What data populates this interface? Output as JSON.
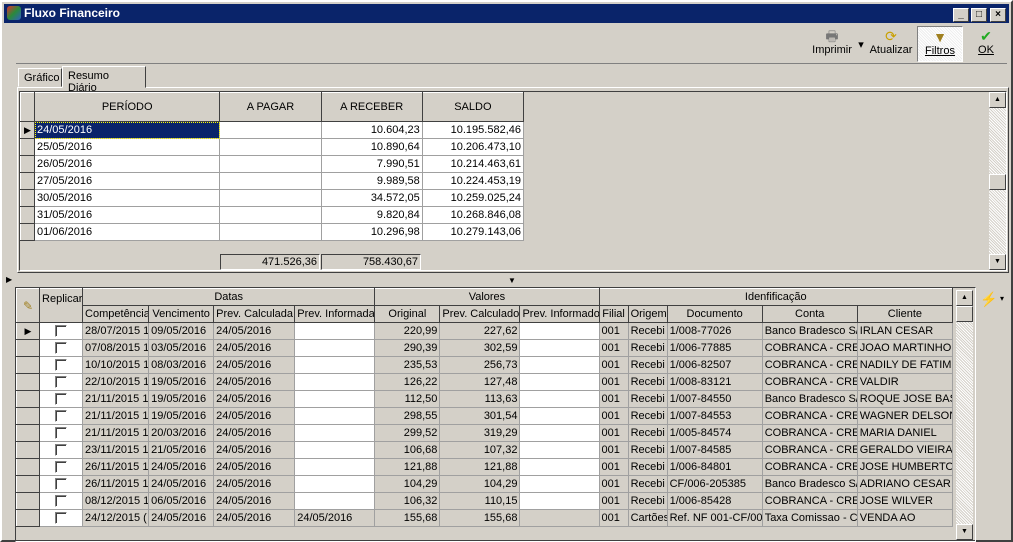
{
  "window": {
    "title": "Fluxo Financeiro",
    "min": "_",
    "max": "□",
    "close": "×"
  },
  "toolbar": {
    "print": "Imprimir",
    "refresh": "Atualizar",
    "filters": "Filtros",
    "ok": "OK"
  },
  "tabs": [
    {
      "label": "Gráfico"
    },
    {
      "label": "Resumo Diário"
    }
  ],
  "summary": {
    "columns": [
      "PERÍODO",
      "A PAGAR",
      "A RECEBER",
      "SALDO"
    ],
    "rows": [
      [
        "24/05/2016",
        "",
        "10.604,23",
        "10.195.582,46"
      ],
      [
        "25/05/2016",
        "",
        "10.890,64",
        "10.206.473,10"
      ],
      [
        "26/05/2016",
        "",
        "7.990,51",
        "10.214.463,61"
      ],
      [
        "27/05/2016",
        "",
        "9.989,58",
        "10.224.453,19"
      ],
      [
        "30/05/2016",
        "",
        "34.572,05",
        "10.259.025,24"
      ],
      [
        "31/05/2016",
        "",
        "9.820,84",
        "10.268.846,08"
      ],
      [
        "01/06/2016",
        "",
        "10.296,98",
        "10.279.143,06"
      ]
    ],
    "total_pagar": "471.526,36",
    "total_receber": "758.430,67"
  },
  "detail": {
    "groups": {
      "replicar": "Replicar",
      "datas": "Datas",
      "valores": "Valores",
      "identificacao": "Idenfificação"
    },
    "columns": [
      "Competência",
      "Vencimento",
      "Prev. Calculada",
      "Prev. Informada",
      "Original",
      "Prev. Calculado",
      "Prev. Informado",
      "Filial",
      "Origem",
      "Documento",
      "Conta",
      "Cliente"
    ],
    "rows": [
      [
        "28/07/2015 1",
        "09/05/2016",
        "24/05/2016",
        "",
        "220,99",
        "227,62",
        "",
        "001",
        "Recebi",
        "1/008-77026",
        "Banco Bradesco S/",
        "IRLAN CESAR"
      ],
      [
        "07/08/2015 1",
        "03/05/2016",
        "24/05/2016",
        "",
        "290,39",
        "302,59",
        "",
        "001",
        "Recebi",
        "1/006-77885",
        "COBRANCA - CREI",
        "JOAO MARTINHO"
      ],
      [
        "10/10/2015 1",
        "08/03/2016",
        "24/05/2016",
        "",
        "235,53",
        "256,73",
        "",
        "001",
        "Recebi",
        "1/006-82507",
        "COBRANCA - CREI",
        "NADILY DE FATIM"
      ],
      [
        "22/10/2015 1",
        "19/05/2016",
        "24/05/2016",
        "",
        "126,22",
        "127,48",
        "",
        "001",
        "Recebi",
        "1/008-83121",
        "COBRANCA - CREI",
        "VALDIR"
      ],
      [
        "21/11/2015 1",
        "19/05/2016",
        "24/05/2016",
        "",
        "112,50",
        "113,63",
        "",
        "001",
        "Recebi",
        "1/007-84550",
        "Banco Bradesco S/",
        "ROQUE JOSE BAS"
      ],
      [
        "21/11/2015 1",
        "19/05/2016",
        "24/05/2016",
        "",
        "298,55",
        "301,54",
        "",
        "001",
        "Recebi",
        "1/007-84553",
        "COBRANCA - CREI",
        "WAGNER DELSON"
      ],
      [
        "21/11/2015 1",
        "20/03/2016",
        "24/05/2016",
        "",
        "299,52",
        "319,29",
        "",
        "001",
        "Recebi",
        "1/005-84574",
        "COBRANCA - CREI",
        "MARIA DANIEL"
      ],
      [
        "23/11/2015 1",
        "21/05/2016",
        "24/05/2016",
        "",
        "106,68",
        "107,32",
        "",
        "001",
        "Recebi",
        "1/007-84585",
        "COBRANCA - CREI",
        "GERALDO VIEIRA"
      ],
      [
        "26/11/2015 1",
        "24/05/2016",
        "24/05/2016",
        "",
        "121,88",
        "121,88",
        "",
        "001",
        "Recebi",
        "1/006-84801",
        "COBRANCA - CREI",
        "JOSE HUMBERTO"
      ],
      [
        "26/11/2015 1",
        "24/05/2016",
        "24/05/2016",
        "",
        "104,29",
        "104,29",
        "",
        "001",
        "Recebi",
        "CF/006-205385",
        "Banco Bradesco S/",
        "ADRIANO CESAR"
      ],
      [
        "08/12/2015 1",
        "06/05/2016",
        "24/05/2016",
        "",
        "106,32",
        "110,15",
        "",
        "001",
        "Recebi",
        "1/006-85428",
        "COBRANCA - CREI",
        "JOSE WILVER"
      ],
      [
        "24/12/2015 (",
        "24/05/2016",
        "24/05/2016",
        "24/05/2016",
        "155,68",
        "155,68",
        "",
        "001",
        "Cartões",
        "Ref. NF 001-CF/00",
        "Taxa Comissao - Ca",
        "VENDA AO"
      ]
    ]
  }
}
